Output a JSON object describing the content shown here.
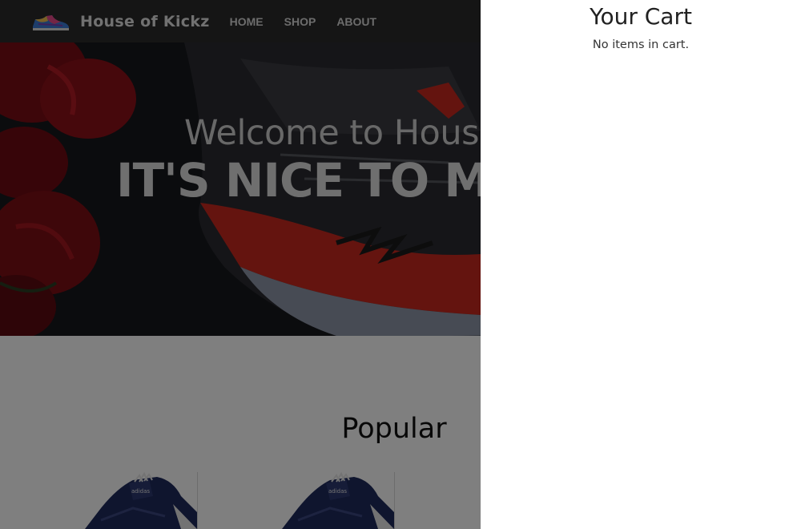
{
  "brand": {
    "name": "House of Kickz",
    "logo_icon": "sneaker-logo-icon"
  },
  "nav": {
    "links": [
      {
        "label": "HOME"
      },
      {
        "label": "SHOP"
      },
      {
        "label": "ABOUT"
      }
    ]
  },
  "hero": {
    "welcome": "Welcome to House",
    "headline": "IT'S NICE TO M"
  },
  "popular": {
    "title": "Popular",
    "products": [
      {
        "image_icon": "adidas-sneaker-icon"
      },
      {
        "image_icon": "adidas-sneaker-icon"
      }
    ]
  },
  "cart": {
    "title": "Your Cart",
    "empty_message": "No items in cart."
  },
  "colors": {
    "navbar": "#2b2b2b",
    "hero_bg": "#15161a",
    "sneaker_red": "#c8281e",
    "sneaker_navy": "#1f2a5c"
  }
}
